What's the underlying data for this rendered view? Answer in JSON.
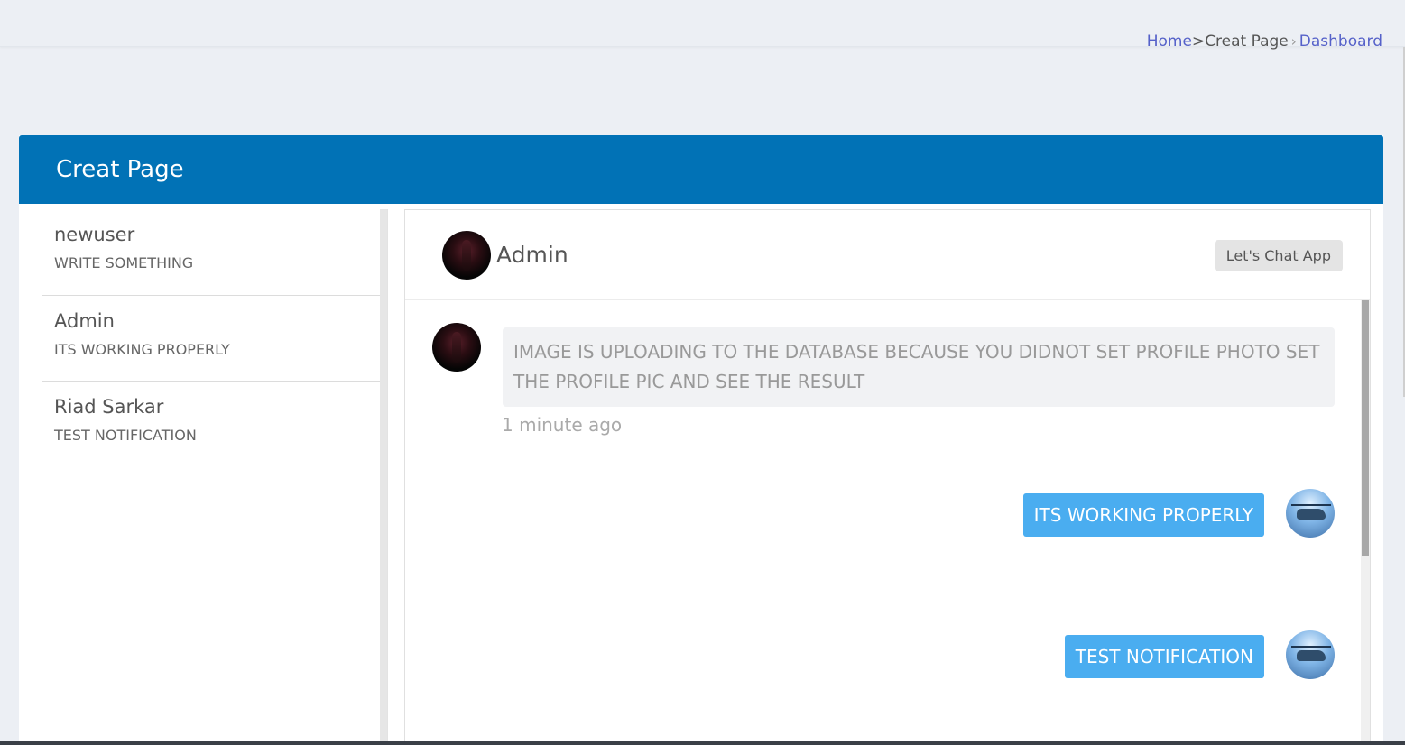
{
  "breadcrumb": {
    "home": "Home",
    "separator": ">",
    "current": "Creat Page",
    "dashboard": "Dashboard"
  },
  "card": {
    "title": "Creat Page"
  },
  "contacts": [
    {
      "name": "newuser",
      "last_message": "WRITE SOMETHING"
    },
    {
      "name": "Admin",
      "last_message": "ITS WORKING PROPERLY"
    },
    {
      "name": "Riad Sarkar",
      "last_message": "TEST NOTIFICATION"
    }
  ],
  "chat": {
    "header_name": "Admin",
    "app_button_label": "Let's Chat App",
    "messages": [
      {
        "direction": "incoming",
        "text": "IMAGE IS UPLOADING TO THE DATABASE BECAUSE YOU DIDNOT SET PROFILE PHOTO SET THE PROFILE PIC AND SEE THE RESULT",
        "time": "1 minute ago"
      },
      {
        "direction": "outgoing",
        "text": "ITS WORKING PROPERLY"
      },
      {
        "direction": "outgoing",
        "text": "TEST NOTIFICATION"
      }
    ]
  },
  "colors": {
    "header_blue": "#0172b6",
    "outgoing_bubble": "#4aadf0",
    "link": "#5561c9"
  }
}
